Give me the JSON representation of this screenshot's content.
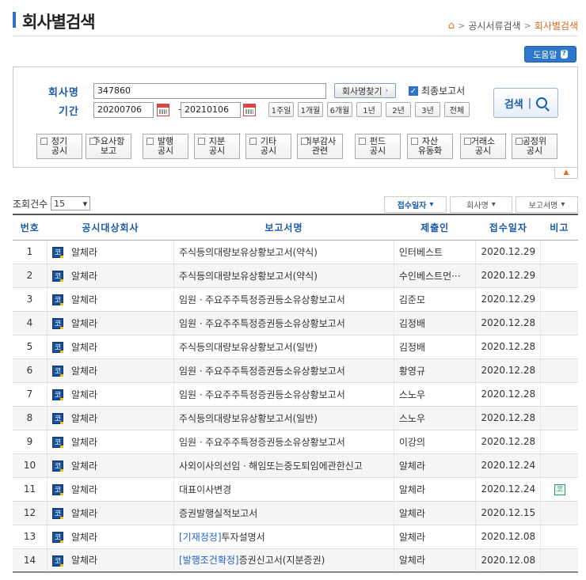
{
  "page": {
    "title": "회사별검색",
    "breadcrumb": [
      "공시서류검색",
      "회사별검색"
    ],
    "help_label": "도움말",
    "help_badge": "?"
  },
  "search": {
    "company_label": "회사명",
    "company_value": "347860",
    "find_company_label": "회사명찾기",
    "final_report_label": "최종보고서",
    "final_report_checked": true,
    "period_label": "기간",
    "start_date": "20200706",
    "end_date": "20210106",
    "period_buttons": [
      "1주일",
      "1개월",
      "6개월",
      "1년",
      "2년",
      "3년",
      "전체"
    ],
    "search_label": "검색",
    "categories": [
      [
        "정기",
        "공시"
      ],
      [
        "주요사항",
        "보고"
      ],
      [
        "발행",
        "공시"
      ],
      [
        "지분",
        "공시"
      ],
      [
        "기타",
        "공시"
      ],
      [
        "외부감사",
        "관련"
      ],
      [
        "펀드",
        "공시"
      ],
      [
        "자산",
        "유동화"
      ],
      [
        "거래소",
        "공시"
      ],
      [
        "공정위",
        "공시"
      ]
    ]
  },
  "list": {
    "count_label": "조회건수",
    "count_value": "15",
    "sort_buttons": [
      "접수일자",
      "회사명",
      "보고서명"
    ],
    "columns": [
      "번호",
      "공시대상회사",
      "보고서명",
      "제출인",
      "접수일자",
      "비고"
    ],
    "market_mark": "코",
    "rows": [
      {
        "no": "1",
        "company": "알체라",
        "tag": "",
        "report": "주식등의대량보유상황보고서(약식)",
        "submitter": "인터베스트",
        "date": "2020.12.29",
        "remark": ""
      },
      {
        "no": "2",
        "company": "알체라",
        "tag": "",
        "report": "주식등의대량보유상황보고서(약식)",
        "submitter": "수인베스트먼···",
        "date": "2020.12.29",
        "remark": ""
      },
      {
        "no": "3",
        "company": "알체라",
        "tag": "",
        "report": "임원ㆍ주요주주특정증권등소유상황보고서",
        "submitter": "김준모",
        "date": "2020.12.29",
        "remark": ""
      },
      {
        "no": "4",
        "company": "알체라",
        "tag": "",
        "report": "임원ㆍ주요주주특정증권등소유상황보고서",
        "submitter": "김정배",
        "date": "2020.12.28",
        "remark": ""
      },
      {
        "no": "5",
        "company": "알체라",
        "tag": "",
        "report": "주식등의대량보유상황보고서(일반)",
        "submitter": "김정배",
        "date": "2020.12.28",
        "remark": ""
      },
      {
        "no": "6",
        "company": "알체라",
        "tag": "",
        "report": "임원ㆍ주요주주특정증권등소유상황보고서",
        "submitter": "황영규",
        "date": "2020.12.28",
        "remark": ""
      },
      {
        "no": "7",
        "company": "알체라",
        "tag": "",
        "report": "임원ㆍ주요주주특정증권등소유상황보고서",
        "submitter": "스노우",
        "date": "2020.12.28",
        "remark": ""
      },
      {
        "no": "8",
        "company": "알체라",
        "tag": "",
        "report": "주식등의대량보유상황보고서(일반)",
        "submitter": "스노우",
        "date": "2020.12.28",
        "remark": ""
      },
      {
        "no": "9",
        "company": "알체라",
        "tag": "",
        "report": "임원ㆍ주요주주특정증권등소유상황보고서",
        "submitter": "이강의",
        "date": "2020.12.28",
        "remark": ""
      },
      {
        "no": "10",
        "company": "알체라",
        "tag": "",
        "report": "사외이사의선임ㆍ해임또는중도퇴임에관한신고",
        "submitter": "알체라",
        "date": "2020.12.24",
        "remark": ""
      },
      {
        "no": "11",
        "company": "알체라",
        "tag": "",
        "report": "대표이사변경",
        "submitter": "알체라",
        "date": "2020.12.24",
        "remark": "코"
      },
      {
        "no": "12",
        "company": "알체라",
        "tag": "",
        "report": "증권발행실적보고서",
        "submitter": "알체라",
        "date": "2020.12.15",
        "remark": ""
      },
      {
        "no": "13",
        "company": "알체라",
        "tag": "[기재정정]",
        "report": "투자설명서",
        "submitter": "알체라",
        "date": "2020.12.08",
        "remark": ""
      },
      {
        "no": "14",
        "company": "알체라",
        "tag": "[발행조건확정]",
        "report": "증권신고서(지분증권)",
        "submitter": "알체라",
        "date": "2020.12.08",
        "remark": ""
      }
    ]
  }
}
